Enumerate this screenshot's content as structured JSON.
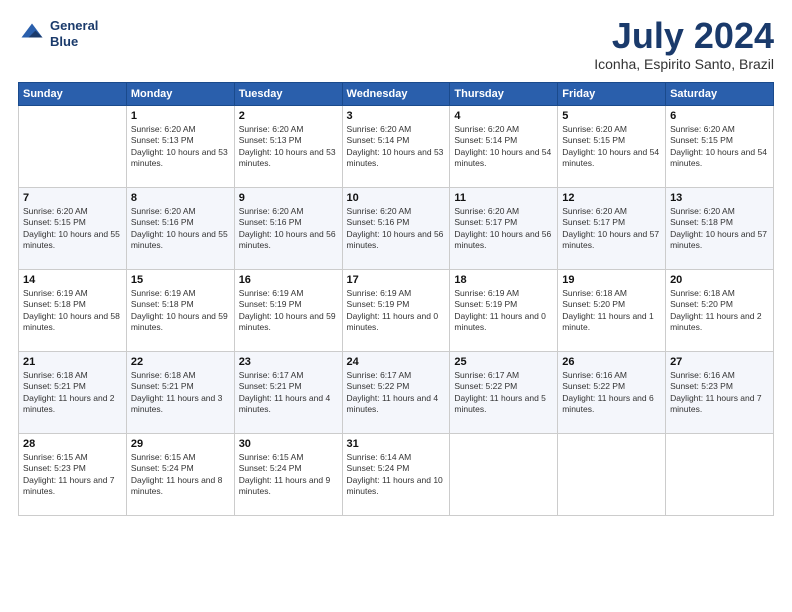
{
  "logo": {
    "line1": "General",
    "line2": "Blue"
  },
  "title": "July 2024",
  "subtitle": "Iconha, Espirito Santo, Brazil",
  "days_header": [
    "Sunday",
    "Monday",
    "Tuesday",
    "Wednesday",
    "Thursday",
    "Friday",
    "Saturday"
  ],
  "weeks": [
    [
      {
        "num": "",
        "sunrise": "",
        "sunset": "",
        "daylight": ""
      },
      {
        "num": "1",
        "sunrise": "Sunrise: 6:20 AM",
        "sunset": "Sunset: 5:13 PM",
        "daylight": "Daylight: 10 hours and 53 minutes."
      },
      {
        "num": "2",
        "sunrise": "Sunrise: 6:20 AM",
        "sunset": "Sunset: 5:13 PM",
        "daylight": "Daylight: 10 hours and 53 minutes."
      },
      {
        "num": "3",
        "sunrise": "Sunrise: 6:20 AM",
        "sunset": "Sunset: 5:14 PM",
        "daylight": "Daylight: 10 hours and 53 minutes."
      },
      {
        "num": "4",
        "sunrise": "Sunrise: 6:20 AM",
        "sunset": "Sunset: 5:14 PM",
        "daylight": "Daylight: 10 hours and 54 minutes."
      },
      {
        "num": "5",
        "sunrise": "Sunrise: 6:20 AM",
        "sunset": "Sunset: 5:15 PM",
        "daylight": "Daylight: 10 hours and 54 minutes."
      },
      {
        "num": "6",
        "sunrise": "Sunrise: 6:20 AM",
        "sunset": "Sunset: 5:15 PM",
        "daylight": "Daylight: 10 hours and 54 minutes."
      }
    ],
    [
      {
        "num": "7",
        "sunrise": "Sunrise: 6:20 AM",
        "sunset": "Sunset: 5:15 PM",
        "daylight": "Daylight: 10 hours and 55 minutes."
      },
      {
        "num": "8",
        "sunrise": "Sunrise: 6:20 AM",
        "sunset": "Sunset: 5:16 PM",
        "daylight": "Daylight: 10 hours and 55 minutes."
      },
      {
        "num": "9",
        "sunrise": "Sunrise: 6:20 AM",
        "sunset": "Sunset: 5:16 PM",
        "daylight": "Daylight: 10 hours and 56 minutes."
      },
      {
        "num": "10",
        "sunrise": "Sunrise: 6:20 AM",
        "sunset": "Sunset: 5:16 PM",
        "daylight": "Daylight: 10 hours and 56 minutes."
      },
      {
        "num": "11",
        "sunrise": "Sunrise: 6:20 AM",
        "sunset": "Sunset: 5:17 PM",
        "daylight": "Daylight: 10 hours and 56 minutes."
      },
      {
        "num": "12",
        "sunrise": "Sunrise: 6:20 AM",
        "sunset": "Sunset: 5:17 PM",
        "daylight": "Daylight: 10 hours and 57 minutes."
      },
      {
        "num": "13",
        "sunrise": "Sunrise: 6:20 AM",
        "sunset": "Sunset: 5:18 PM",
        "daylight": "Daylight: 10 hours and 57 minutes."
      }
    ],
    [
      {
        "num": "14",
        "sunrise": "Sunrise: 6:19 AM",
        "sunset": "Sunset: 5:18 PM",
        "daylight": "Daylight: 10 hours and 58 minutes."
      },
      {
        "num": "15",
        "sunrise": "Sunrise: 6:19 AM",
        "sunset": "Sunset: 5:18 PM",
        "daylight": "Daylight: 10 hours and 59 minutes."
      },
      {
        "num": "16",
        "sunrise": "Sunrise: 6:19 AM",
        "sunset": "Sunset: 5:19 PM",
        "daylight": "Daylight: 10 hours and 59 minutes."
      },
      {
        "num": "17",
        "sunrise": "Sunrise: 6:19 AM",
        "sunset": "Sunset: 5:19 PM",
        "daylight": "Daylight: 11 hours and 0 minutes."
      },
      {
        "num": "18",
        "sunrise": "Sunrise: 6:19 AM",
        "sunset": "Sunset: 5:19 PM",
        "daylight": "Daylight: 11 hours and 0 minutes."
      },
      {
        "num": "19",
        "sunrise": "Sunrise: 6:18 AM",
        "sunset": "Sunset: 5:20 PM",
        "daylight": "Daylight: 11 hours and 1 minute."
      },
      {
        "num": "20",
        "sunrise": "Sunrise: 6:18 AM",
        "sunset": "Sunset: 5:20 PM",
        "daylight": "Daylight: 11 hours and 2 minutes."
      }
    ],
    [
      {
        "num": "21",
        "sunrise": "Sunrise: 6:18 AM",
        "sunset": "Sunset: 5:21 PM",
        "daylight": "Daylight: 11 hours and 2 minutes."
      },
      {
        "num": "22",
        "sunrise": "Sunrise: 6:18 AM",
        "sunset": "Sunset: 5:21 PM",
        "daylight": "Daylight: 11 hours and 3 minutes."
      },
      {
        "num": "23",
        "sunrise": "Sunrise: 6:17 AM",
        "sunset": "Sunset: 5:21 PM",
        "daylight": "Daylight: 11 hours and 4 minutes."
      },
      {
        "num": "24",
        "sunrise": "Sunrise: 6:17 AM",
        "sunset": "Sunset: 5:22 PM",
        "daylight": "Daylight: 11 hours and 4 minutes."
      },
      {
        "num": "25",
        "sunrise": "Sunrise: 6:17 AM",
        "sunset": "Sunset: 5:22 PM",
        "daylight": "Daylight: 11 hours and 5 minutes."
      },
      {
        "num": "26",
        "sunrise": "Sunrise: 6:16 AM",
        "sunset": "Sunset: 5:22 PM",
        "daylight": "Daylight: 11 hours and 6 minutes."
      },
      {
        "num": "27",
        "sunrise": "Sunrise: 6:16 AM",
        "sunset": "Sunset: 5:23 PM",
        "daylight": "Daylight: 11 hours and 7 minutes."
      }
    ],
    [
      {
        "num": "28",
        "sunrise": "Sunrise: 6:15 AM",
        "sunset": "Sunset: 5:23 PM",
        "daylight": "Daylight: 11 hours and 7 minutes."
      },
      {
        "num": "29",
        "sunrise": "Sunrise: 6:15 AM",
        "sunset": "Sunset: 5:24 PM",
        "daylight": "Daylight: 11 hours and 8 minutes."
      },
      {
        "num": "30",
        "sunrise": "Sunrise: 6:15 AM",
        "sunset": "Sunset: 5:24 PM",
        "daylight": "Daylight: 11 hours and 9 minutes."
      },
      {
        "num": "31",
        "sunrise": "Sunrise: 6:14 AM",
        "sunset": "Sunset: 5:24 PM",
        "daylight": "Daylight: 11 hours and 10 minutes."
      },
      {
        "num": "",
        "sunrise": "",
        "sunset": "",
        "daylight": ""
      },
      {
        "num": "",
        "sunrise": "",
        "sunset": "",
        "daylight": ""
      },
      {
        "num": "",
        "sunrise": "",
        "sunset": "",
        "daylight": ""
      }
    ]
  ]
}
